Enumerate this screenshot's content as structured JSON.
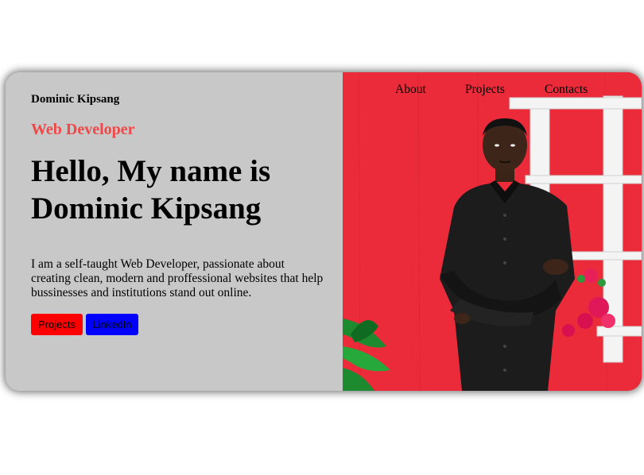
{
  "header": {
    "brand": "Dominic Kipsang"
  },
  "nav": {
    "about": "About",
    "projects": "Projects",
    "contacts": "Contacts"
  },
  "hero": {
    "role": "Web Developer",
    "headline_line1": "Hello, My name is",
    "headline_line2": "Dominic Kipsang",
    "intro": "I am a self-taught Web Developer, passionate about creating clean, modern and proffessional websites that help bussinesses and institutions stand out online.",
    "buttons": {
      "projects": "Projects",
      "linkedin": "LinkedIn"
    }
  },
  "colors": {
    "left_panel": "#c8c8c8",
    "role_text": "#f04848",
    "projects_button": "#ff0000",
    "linkedin_button": "#0000ff",
    "photo_background": "#ec2b3a"
  }
}
